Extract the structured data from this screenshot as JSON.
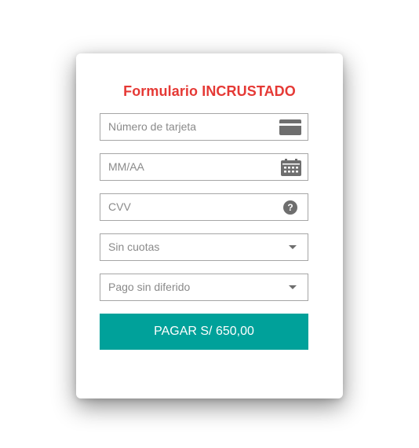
{
  "form": {
    "title": "Formulario INCRUSTADO",
    "title_color": "#e53935",
    "fields": [
      {
        "placeholder": "Número de tarjeta",
        "icon": "credit-card-icon"
      },
      {
        "placeholder": "MM/AA",
        "icon": "calendar-icon"
      },
      {
        "placeholder": "CVV",
        "icon": "help-circle-icon",
        "icon_glyph": "?"
      },
      {
        "placeholder": "Sin cuotas",
        "icon": "chevron-down-icon"
      },
      {
        "placeholder": "Pago sin diferido",
        "icon": "chevron-down-icon"
      }
    ],
    "pay_button": {
      "label": "PAGAR S/ 650,00",
      "color": "#00a19a"
    },
    "icon_color": "#6e6e6e"
  }
}
